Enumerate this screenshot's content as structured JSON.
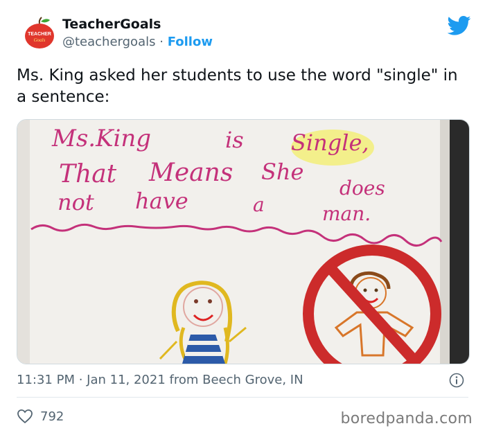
{
  "author": {
    "name": "TeacherGoals",
    "handle": "@teachergoals",
    "separator": "·",
    "follow_label": "Follow",
    "avatar_text_top": "TEACHER",
    "avatar_text_bottom": "Goals"
  },
  "tweet": {
    "text": "Ms. King asked her students to use the word \"single\" in a sentence:"
  },
  "drawing": {
    "line1a": "Ms.King",
    "line1b": "is",
    "line1c": "Single,",
    "line2a": "That",
    "line2b": "Means",
    "line2c": "She",
    "line2d": "does",
    "line3a": "not",
    "line3b": "have",
    "line3c": "a",
    "line3d": "man."
  },
  "meta": {
    "timestamp": "11:31 PM · Jan 11, 2021 from Beech Grove, IN"
  },
  "engagement": {
    "likes": "792"
  },
  "watermark": "boredpanda.com",
  "colors": {
    "twitter_blue": "#1d9bf0",
    "crayon_pink": "#c4317a",
    "crayon_red": "#cc2b2b",
    "highlighter_yellow": "#f3ef7a"
  }
}
